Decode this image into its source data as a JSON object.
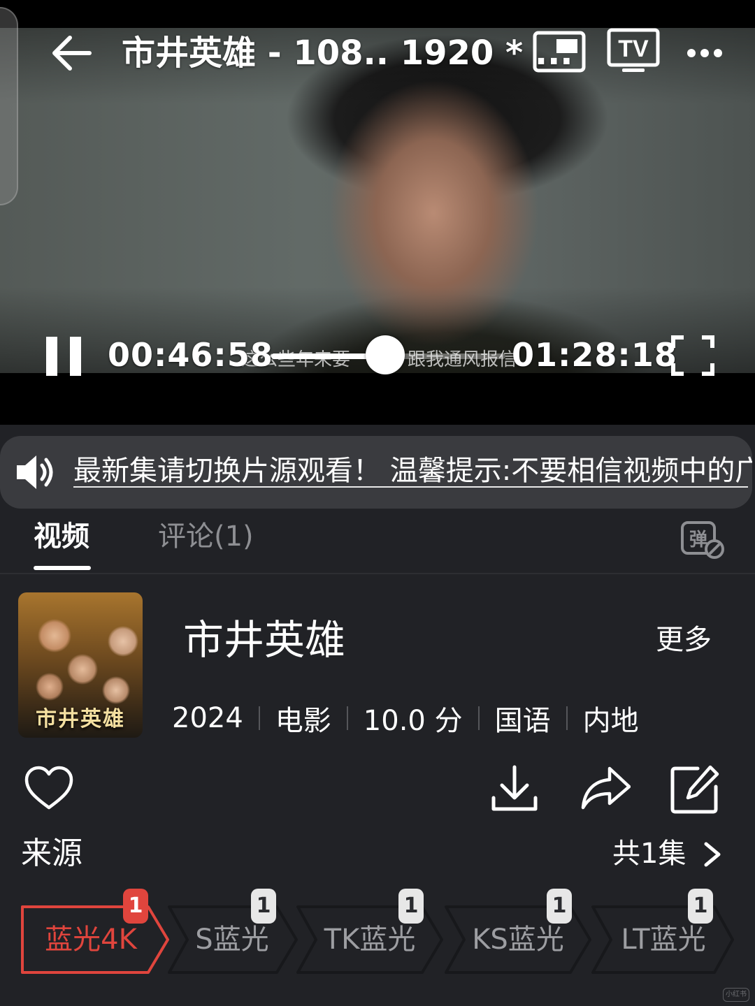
{
  "player": {
    "title": "市井英雄 - 108.. 1920 * ...",
    "subtitle_left": "这么些年来要",
    "subtitle_right": "跟我通风报信",
    "current_time": "00:46:58",
    "total_time": "01:28:18",
    "progress_fraction": 0.53
  },
  "notice": {
    "text": "最新集请切换片源观看！          温馨提示:不要相信视频中的广告"
  },
  "tabs": [
    {
      "label": "视频",
      "active": true
    },
    {
      "label": "评论(1)",
      "active": false
    }
  ],
  "danmaku_icon_char": "弹",
  "movie": {
    "poster_caption": "市井英雄",
    "title": "市井英雄",
    "more": "更多",
    "year": "2024",
    "type": "电影",
    "score": "10.0 分",
    "language": "国语",
    "region": "内地"
  },
  "source": {
    "label": "来源",
    "episode_count": "共1集",
    "items": [
      {
        "label": "蓝光4K",
        "badge": "1",
        "active": true
      },
      {
        "label": "S蓝光",
        "badge": "1",
        "active": false
      },
      {
        "label": "TK蓝光",
        "badge": "1",
        "active": false
      },
      {
        "label": "KS蓝光",
        "badge": "1",
        "active": false
      },
      {
        "label": "LT蓝光",
        "badge": "1",
        "active": false
      }
    ]
  },
  "colors": {
    "accent": "#e0453d",
    "background": "#212226"
  },
  "watermark": "小红书"
}
